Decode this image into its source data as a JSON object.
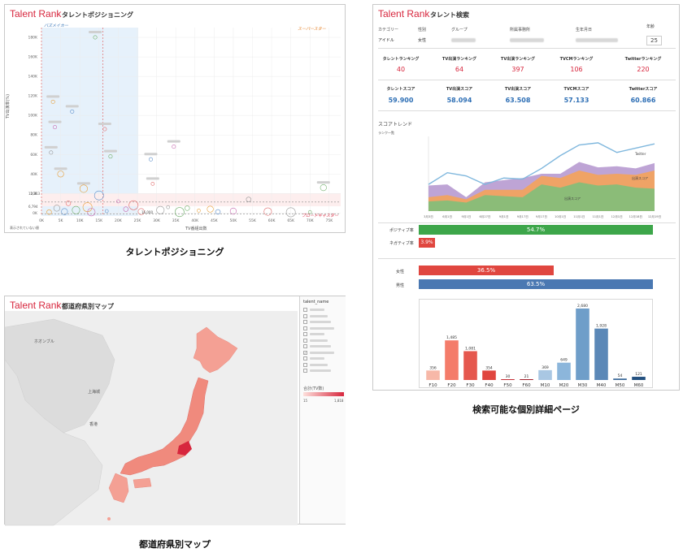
{
  "positioning": {
    "brand": "Talent Rank",
    "title": "タレントポジショニング",
    "caption": "タレントポジショニング",
    "y_axis_label": "TV出演率(%)",
    "x_axis_label": "TV番組出数",
    "corner_label": "表示されていない値",
    "quadrants": {
      "top_left": "バズメイカー",
      "top_right": "スーパースター",
      "bottom_right": "ブロードキャスター"
    },
    "ref_labels": {
      "y_ref": "11,313",
      "y_ref2": "6,794",
      "x_ref": "16,000"
    }
  },
  "detail": {
    "brand": "Talent Rank",
    "title": "タレント検索",
    "caption": "検索可能な個別詳細ページ",
    "info_headers": [
      "カテゴリー",
      "性別",
      "グループ",
      "所属事務所",
      "生年月日",
      "年齢"
    ],
    "info_values": {
      "category": "アイドル",
      "gender": "女性",
      "age": "25"
    },
    "ranking_headers": [
      "タレントランキング",
      "TV出演ランキング",
      "TV出演ランキング",
      "TVCMランキング",
      "Twitterランキング"
    ],
    "ranking_values": [
      "40",
      "64",
      "397",
      "106",
      "220"
    ],
    "score_headers": [
      "タレントスコア",
      "TV出演スコア",
      "TV出演スコア",
      "TVCMスコア",
      "Twitterスコア"
    ],
    "score_values": [
      "59.900",
      "58.094",
      "63.508",
      "57.133",
      "60.866"
    ],
    "trend_title": "スコアトレンド",
    "trend_ylabel": "ランク一覧",
    "trend_series_labels": {
      "tw": "Twitter",
      "cm": "出演スコア",
      "tv": "出演スコア"
    },
    "trend_months": [
      "3月3日",
      "6月1日",
      "9月1日",
      "6月27日",
      "9月1日",
      "9月17日",
      "9月17日",
      "10月1日",
      "11月1日",
      "11月1日",
      "12月1日",
      "12月18日",
      "12月19日"
    ],
    "sentiment_labels": [
      "ポジティブ率",
      "ネガティブ率"
    ],
    "sentiment_values": [
      "54.7%",
      "3.9%"
    ],
    "gender_labels": [
      "女性",
      "男性"
    ],
    "gender_values": [
      "36.5%",
      "63.5%"
    ]
  },
  "map": {
    "brand": "Talent Rank",
    "title": "都道府県別マップ",
    "caption": "都道府県別マップ",
    "filter_title": "talent_name",
    "region_labels": [
      "ホオンブル",
      "上海城",
      "香港"
    ],
    "color_legend_title": "合計(TV数)",
    "color_min": "15",
    "color_max": "1,818"
  },
  "chart_data": [
    {
      "type": "scatter",
      "title": "タレントポジショニング",
      "xlabel": "TV番組出数",
      "ylabel": "TV出演率(%)",
      "xlim": [
        0,
        78000
      ],
      "ylim": [
        -3000,
        190000
      ],
      "x_ticks": [
        "0K",
        "5K",
        "10K",
        "15K",
        "20K",
        "25K",
        "30K",
        "35K",
        "40K",
        "45K",
        "50K",
        "55K",
        "60K",
        "65K",
        "70K",
        "75K"
      ],
      "y_ticks": [
        "0K",
        "20K",
        "40K",
        "60K",
        "80K",
        "100K",
        "120K",
        "140K",
        "160K",
        "180K"
      ],
      "points": [
        {
          "x": 14000,
          "y": 180000
        },
        {
          "x": 3000,
          "y": 114000
        },
        {
          "x": 8000,
          "y": 104000
        },
        {
          "x": 3500,
          "y": 88000
        },
        {
          "x": 16500,
          "y": 86000
        },
        {
          "x": 2500,
          "y": 62000
        },
        {
          "x": 18000,
          "y": 58000
        },
        {
          "x": 5000,
          "y": 40000
        },
        {
          "x": 28500,
          "y": 55000
        },
        {
          "x": 34500,
          "y": 68000
        },
        {
          "x": 29000,
          "y": 30000
        },
        {
          "x": 54000,
          "y": 14000
        },
        {
          "x": 73500,
          "y": 26000
        },
        {
          "x": 11000,
          "y": 25000
        },
        {
          "x": 15000,
          "y": 18000
        },
        {
          "x": 20000,
          "y": 12000
        },
        {
          "x": 7000,
          "y": 10000
        },
        {
          "x": 4000,
          "y": 5000
        },
        {
          "x": 9000,
          "y": 3000
        },
        {
          "x": 12000,
          "y": 6000
        },
        {
          "x": 17000,
          "y": 2000
        },
        {
          "x": 22000,
          "y": 4000
        },
        {
          "x": 26000,
          "y": 1500
        },
        {
          "x": 31000,
          "y": 3000
        },
        {
          "x": 36000,
          "y": 1000
        },
        {
          "x": 41000,
          "y": 2500
        },
        {
          "x": 46000,
          "y": 1200
        },
        {
          "x": 50000,
          "y": 2000
        },
        {
          "x": 59000,
          "y": 1500
        },
        {
          "x": 65000,
          "y": 800
        },
        {
          "x": 70000,
          "y": 1000
        },
        {
          "x": 2000,
          "y": 1000
        },
        {
          "x": 6000,
          "y": 1500
        },
        {
          "x": 13000,
          "y": 1000
        },
        {
          "x": 24000,
          "y": 8000
        },
        {
          "x": 33000,
          "y": 6000
        },
        {
          "x": 38000,
          "y": 5000
        },
        {
          "x": 44000,
          "y": 4000
        }
      ]
    },
    {
      "type": "area",
      "title": "スコアトレンド",
      "categories": [
        "3月3日",
        "6月1日",
        "9月1日",
        "6月27日",
        "9月1日",
        "9月17日",
        "9月17日",
        "10月1日",
        "11月1日",
        "11月1日",
        "12月1日",
        "12月18日",
        "12月19日"
      ],
      "series": [
        {
          "name": "出演スコア",
          "values": [
            9,
            10,
            8,
            15,
            14,
            13,
            25,
            22,
            27,
            24,
            25,
            22,
            21
          ]
        },
        {
          "name": "出演スコア",
          "values": [
            13,
            15,
            11,
            20,
            20,
            20,
            33,
            31,
            38,
            34,
            35,
            34,
            38
          ]
        },
        {
          "name": "Twitter",
          "values": [
            24,
            25,
            13,
            27,
            29,
            31,
            35,
            35,
            46,
            41,
            42,
            40,
            45
          ]
        }
      ],
      "line": {
        "name": "Twitter",
        "values": [
          25,
          36,
          33,
          25,
          31,
          30,
          40,
          52,
          62,
          64,
          55,
          59,
          63
        ]
      }
    },
    {
      "type": "bar",
      "categories": [
        "F10",
        "F20",
        "F30",
        "F40",
        "F50",
        "F60",
        "M10",
        "M20",
        "M30",
        "M40",
        "M50",
        "M60"
      ],
      "values": [
        356,
        1485,
        1081,
        354,
        30,
        21,
        369,
        649,
        2680,
        1928,
        54,
        121
      ],
      "value_labels": [
        "356",
        "1,485",
        "1,081",
        "354",
        "30",
        "21",
        "369",
        "649",
        "2,680",
        "1,928",
        "54",
        "121"
      ],
      "colors": [
        "#f7b8a8",
        "#f47c6a",
        "#e5584e",
        "#e0463f",
        "#c42c33",
        "#a01f2a",
        "#a9c7e3",
        "#8cb6db",
        "#6f9ec9",
        "#5b88b7",
        "#3e6c9c",
        "#23507f"
      ]
    }
  ]
}
